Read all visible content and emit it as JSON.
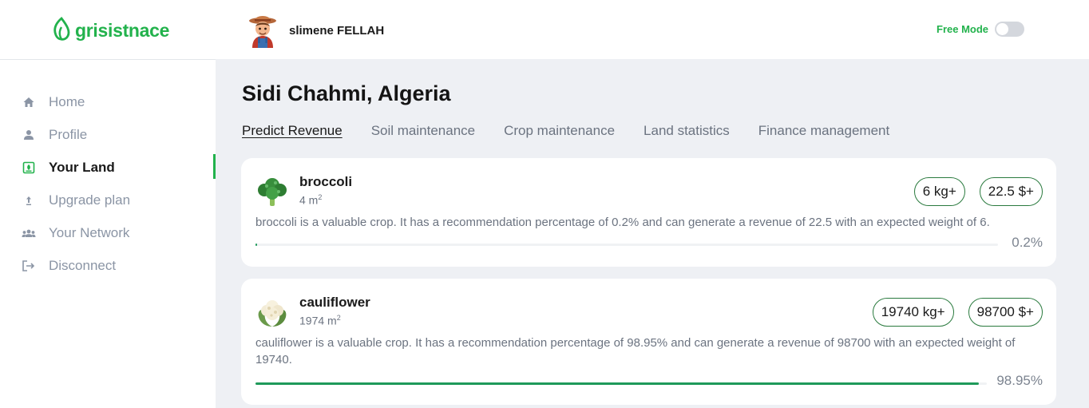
{
  "brand": {
    "name": "grisistnace",
    "color": "#22b24c"
  },
  "user": {
    "name": "slimene FELLAH",
    "avatar_icon": "farmer-avatar-icon"
  },
  "free_mode": {
    "label": "Free Mode",
    "enabled": false
  },
  "sidebar": {
    "items": [
      {
        "label": "Home",
        "icon": "home-icon",
        "active": false
      },
      {
        "label": "Profile",
        "icon": "user-icon",
        "active": false
      },
      {
        "label": "Your Land",
        "icon": "land-icon",
        "active": true
      },
      {
        "label": "Upgrade plan",
        "icon": "upload-arrow-icon",
        "active": false
      },
      {
        "label": "Your Network",
        "icon": "group-icon",
        "active": false
      },
      {
        "label": "Disconnect",
        "icon": "logout-icon",
        "active": false
      }
    ]
  },
  "main": {
    "title": "Sidi Chahmi, Algeria",
    "tabs": [
      {
        "label": "Predict Revenue",
        "active": true
      },
      {
        "label": "Soil maintenance",
        "active": false
      },
      {
        "label": "Crop maintenance",
        "active": false
      },
      {
        "label": "Land statistics",
        "active": false
      },
      {
        "label": "Finance management",
        "active": false
      }
    ],
    "crops": [
      {
        "name": "broccoli",
        "area": "4 m",
        "area_sup": "2",
        "weight": "6 kg+",
        "revenue": "22.5 $+",
        "description": "broccoli is a valuable crop. It has a recommendation percentage of 0.2% and can generate a revenue of 22.5 with an expected weight of 6.",
        "percent_label": "0.2%",
        "percent": 0.2,
        "icon": "broccoli-icon"
      },
      {
        "name": "cauliflower",
        "area": "1974 m",
        "area_sup": "2",
        "weight": "19740 kg+",
        "revenue": "98700 $+",
        "description": "cauliflower is a valuable crop. It has a recommendation percentage of 98.95% and can generate a revenue of 98700 with an expected weight of 19740.",
        "percent_label": "98.95%",
        "percent": 98.95,
        "icon": "cauliflower-icon"
      }
    ]
  },
  "colors": {
    "accent": "#22b24c",
    "progress": "#1f9a5a",
    "pill_border": "#2a7a3e"
  }
}
